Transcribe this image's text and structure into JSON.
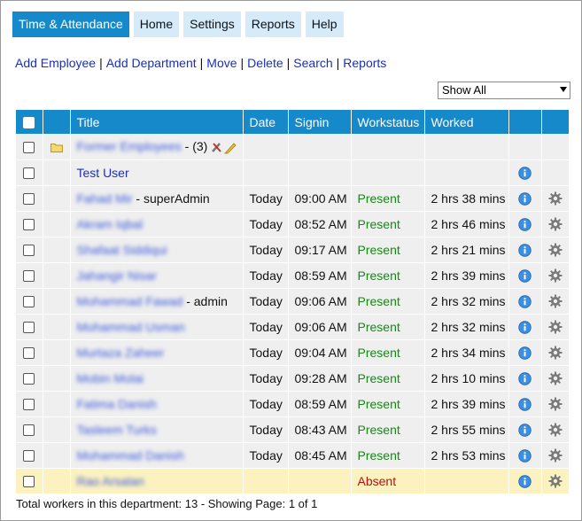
{
  "nav": {
    "tabs": [
      {
        "label": "Time & Attendance",
        "active": true
      },
      {
        "label": "Home"
      },
      {
        "label": "Settings"
      },
      {
        "label": "Reports"
      },
      {
        "label": "Help"
      }
    ]
  },
  "actions": [
    "Add Employee",
    "Add Department",
    "Move",
    "Delete",
    "Search",
    "Reports"
  ],
  "filter": {
    "selected": "Show All"
  },
  "table": {
    "headers": {
      "title": "Title",
      "date": "Date",
      "signin": "Signin",
      "workstatus": "Workstatus",
      "worked": "Worked"
    },
    "department_row": {
      "name": "Former Employees",
      "count": "- (3)"
    },
    "test_row": {
      "name": "Test User"
    },
    "rows": [
      {
        "name": "Fahad Mir",
        "role": "- superAdmin",
        "date": "Today",
        "signin": "09:00 AM",
        "status": "Present",
        "worked": "2 hrs 38 mins"
      },
      {
        "name": "Akram Iqbal",
        "role": "",
        "date": "Today",
        "signin": "08:52 AM",
        "status": "Present",
        "worked": "2 hrs 46 mins"
      },
      {
        "name": "Shafaat Siddiqui",
        "role": "",
        "date": "Today",
        "signin": "09:17 AM",
        "status": "Present",
        "worked": "2 hrs 21 mins"
      },
      {
        "name": "Jahangir Nisar",
        "role": "",
        "date": "Today",
        "signin": "08:59 AM",
        "status": "Present",
        "worked": "2 hrs 39 mins"
      },
      {
        "name": "Mohammad Fawad",
        "role": "- admin",
        "date": "Today",
        "signin": "09:06 AM",
        "status": "Present",
        "worked": "2 hrs 32 mins"
      },
      {
        "name": "Mohammad Usman",
        "role": "",
        "date": "Today",
        "signin": "09:06 AM",
        "status": "Present",
        "worked": "2 hrs 32 mins"
      },
      {
        "name": "Murtaza Zaheer",
        "role": "",
        "date": "Today",
        "signin": "09:04 AM",
        "status": "Present",
        "worked": "2 hrs 34 mins"
      },
      {
        "name": "Mobin Molai",
        "role": "",
        "date": "Today",
        "signin": "09:28 AM",
        "status": "Present",
        "worked": "2 hrs 10 mins"
      },
      {
        "name": "Fatima Danish",
        "role": "",
        "date": "Today",
        "signin": "08:59 AM",
        "status": "Present",
        "worked": "2 hrs 39 mins"
      },
      {
        "name": "Tasleem Turks",
        "role": "",
        "date": "Today",
        "signin": "08:43 AM",
        "status": "Present",
        "worked": "2 hrs 55 mins"
      },
      {
        "name": "Mohammad Danish",
        "role": "",
        "date": "Today",
        "signin": "08:45 AM",
        "status": "Present",
        "worked": "2 hrs 53 mins"
      }
    ],
    "absent_row": {
      "name": "Rao Arsalan",
      "status": "Absent"
    }
  },
  "footer": "Total workers in this department: 13 - Showing Page: 1 of 1",
  "colors": {
    "accent": "#1589c9",
    "tab_inactive": "#d6ebfa",
    "link": "#1a2fbd",
    "present": "#138a13",
    "absent": "#c50b0b",
    "row_bg": "#efefef",
    "absent_bg": "#fcf2c0"
  }
}
